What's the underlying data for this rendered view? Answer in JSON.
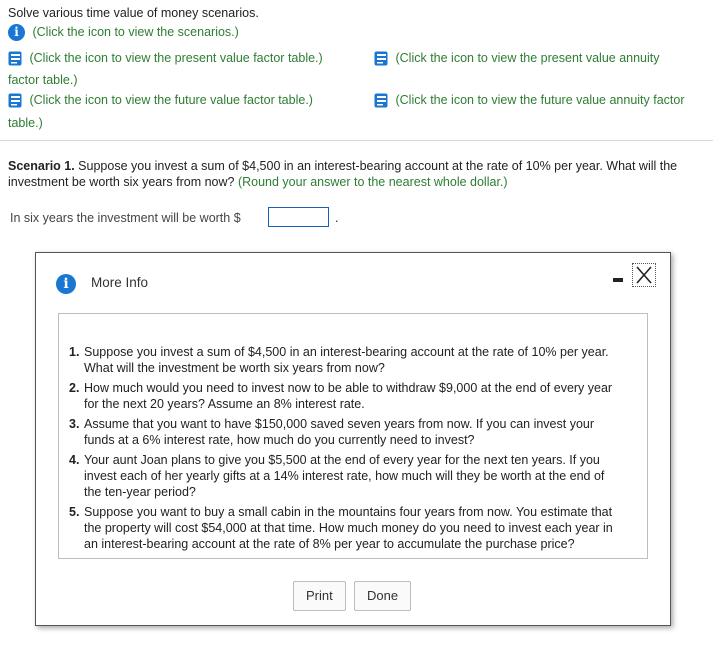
{
  "intro": "Solve various time value of money scenarios.",
  "links": {
    "scenarios": "(Click the icon to view the scenarios.)",
    "pv_factor": "(Click the icon to view the present value factor table.)",
    "pv_annuity_a": "(Click the icon to view the present value annuity",
    "pv_annuity_b": "factor table.)",
    "fv_factor": "(Click the icon to view the future value factor table.)",
    "fv_annuity_a": "(Click the icon to view the future value annuity factor",
    "fv_annuity_b": "table.)"
  },
  "scenario": {
    "label": "Scenario 1.",
    "text_a": " Suppose you invest a sum of $4,500 in an interest-bearing account at the rate of 10% per year. What will the",
    "text_b": "investment be worth six years from now?",
    "hint": " (Round your answer to the nearest whole dollar.)"
  },
  "answer": {
    "prompt": "In six years the investment will be worth $",
    "value": "",
    "suffix": "."
  },
  "modal": {
    "title": "More Info",
    "items": [
      {
        "num": "1.",
        "text": "Suppose you invest a sum of $4,500 in an interest-bearing account at the rate of 10% per year. What will the investment be worth six years from now?"
      },
      {
        "num": "2.",
        "text": "How much would you need to invest now to be able to withdraw $9,000 at the end of every year for the next 20 years? Assume an 8% interest rate."
      },
      {
        "num": "3.",
        "text": "Assume that you want to have $150,000 saved seven years from now. If you can invest your funds at a 6% interest rate, how much do you currently need to invest?"
      },
      {
        "num": "4.",
        "text": "Your aunt Joan plans to give you $5,500 at the end of every year for the next ten years. If you invest each of her yearly gifts at a 14% interest rate, how much will they be worth at the end of the ten-year period?"
      },
      {
        "num": "5.",
        "text": "Suppose you want to buy a small cabin in the mountains four years from now. You estimate that the property will cost $54,000 at that time. How much money do you need to invest each year in an interest-bearing account at the rate of 8% per year to accumulate the purchase price?"
      }
    ],
    "print_label": "Print",
    "done_label": "Done"
  },
  "colors": {
    "link_green": "#2e7d32",
    "info_blue": "#1976d2",
    "box_border": "#1a5fb4"
  }
}
